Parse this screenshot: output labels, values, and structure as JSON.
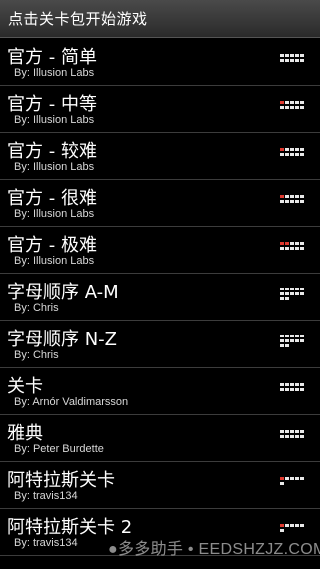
{
  "header": {
    "title": "点击关卡包开始游戏"
  },
  "colors": {
    "progress_filled": "#e8e8e8",
    "progress_accent": "#e0392f",
    "row_divider": "#3c3c3c"
  },
  "levels": [
    {
      "name": "官方 - 简单",
      "author": "By: Illusion Labs",
      "progress": "partial",
      "icon": "level-progress-icon"
    },
    {
      "name": "官方 - 中等",
      "author": "By: Illusion Labs",
      "progress": "partial",
      "icon": "level-progress-icon"
    },
    {
      "name": "官方 - 较难",
      "author": "By: Illusion Labs",
      "progress": "partial",
      "icon": "level-progress-icon"
    },
    {
      "name": "官方 - 很难",
      "author": "By: Illusion Labs",
      "progress": "partial",
      "icon": "level-progress-icon"
    },
    {
      "name": "官方 - 极难",
      "author": "By: Illusion Labs",
      "progress": "partial",
      "icon": "level-progress-icon"
    },
    {
      "name": "字母顺序 A-M",
      "author": "By: Chris",
      "progress": "partial",
      "icon": "level-progress-icon"
    },
    {
      "name": "字母顺序 N-Z",
      "author": "By: Chris",
      "progress": "partial",
      "icon": "level-progress-icon"
    },
    {
      "name": "关卡",
      "author": "By: Arnór Valdimarsson",
      "progress": "partial",
      "icon": "level-progress-icon"
    },
    {
      "name": "雅典",
      "author": "By: Peter Burdette",
      "progress": "partial",
      "icon": "level-progress-icon"
    },
    {
      "name": "阿特拉斯关卡",
      "author": "By: travis134",
      "progress": "partial",
      "icon": "level-progress-icon"
    },
    {
      "name": "阿特拉斯关卡 2",
      "author": "By: travis134",
      "progress": "partial",
      "icon": "level-progress-icon"
    }
  ],
  "watermark": {
    "text": "●多多助手 • EEDSHZJZ.COM"
  }
}
